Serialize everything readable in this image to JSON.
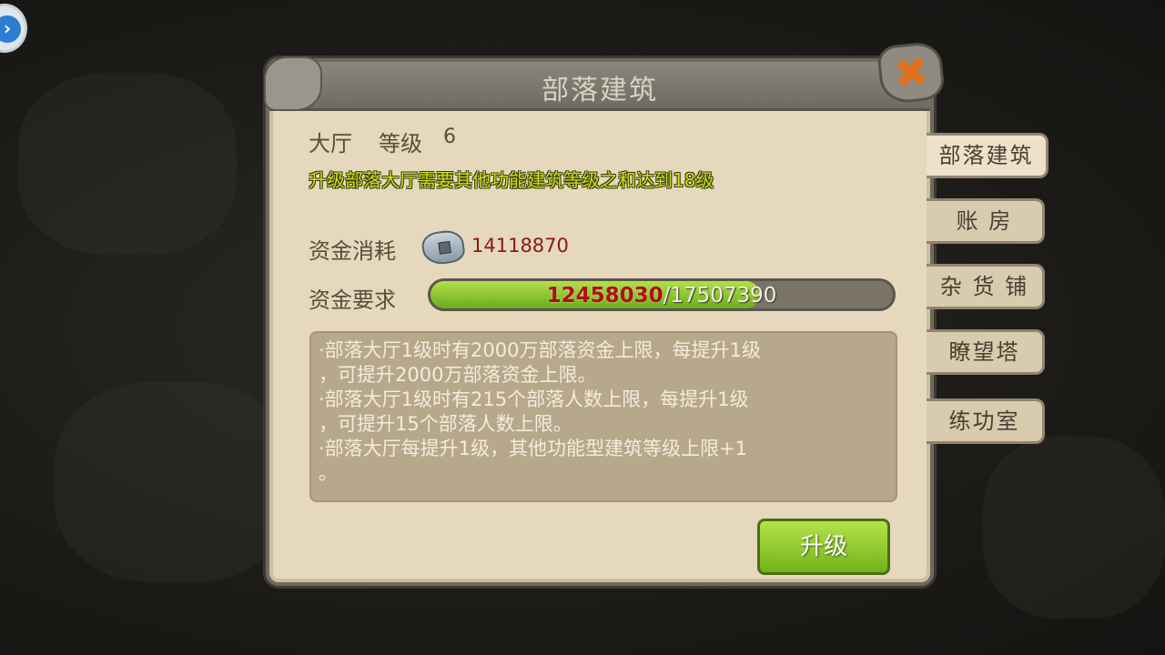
{
  "header": {
    "title": "部落建筑",
    "close_icon": "close-x-icon"
  },
  "building": {
    "name": "大厅",
    "level_label": "等级",
    "level_value": "6"
  },
  "hint": "升级部落大厅需要其他功能建筑等级之和达到18级",
  "cost": {
    "label": "资金消耗",
    "icon": "stone-coin-icon",
    "value": "14118870"
  },
  "requirement": {
    "label": "资金要求",
    "current": "12458030",
    "separator": "/",
    "required": "17507390",
    "progress_fraction": 0.71
  },
  "description": {
    "lines": [
      "·部落大厅1级时有2000万部落资金上限，每提升1级",
      "，可提升2000万部落资金上限。",
      "·部落大厅1级时有215个部落人数上限，每提升1级",
      "，可提升15个部落人数上限。",
      "·部落大厅每提升1级，其他功能型建筑等级上限+1",
      "。"
    ]
  },
  "upgrade_button": "升级",
  "tabs": [
    {
      "label": "部落建筑",
      "active": true
    },
    {
      "label": "账 房",
      "active": false
    },
    {
      "label": "杂 货 铺",
      "active": false
    },
    {
      "label": "瞭望塔",
      "active": false
    },
    {
      "label": "练功室",
      "active": false
    }
  ],
  "floating_button": {
    "icon": "chevron-right-icon",
    "glyph": "›"
  },
  "colors": {
    "hint": "#c8e020",
    "cost_value": "#8a1818",
    "progress_fill": "#8ec82c",
    "upgrade_button": "#8ec82c"
  }
}
